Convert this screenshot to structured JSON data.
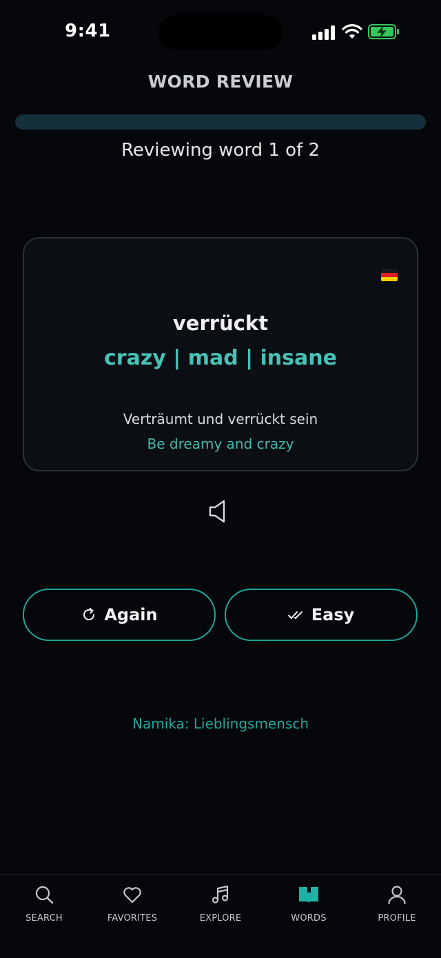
{
  "status_bar": {
    "time": "9:41"
  },
  "header": {
    "title": "WORD REVIEW",
    "progress_text": "Reviewing word 1 of 2",
    "progress_fraction": 0
  },
  "card": {
    "flag_icon": "germany-flag",
    "word": "verrückt",
    "translations": "crazy | mad | insane",
    "example": "Verträumt und verrückt sein",
    "example_translation": "Be dreamy and crazy"
  },
  "actions": {
    "again_label": "Again",
    "easy_label": "Easy"
  },
  "source": "Namika: Lieblingsmensch",
  "tabs": [
    {
      "label": "SEARCH",
      "icon": "search-icon"
    },
    {
      "label": "FAVORITES",
      "icon": "heart-icon"
    },
    {
      "label": "EXPLORE",
      "icon": "music-note-icon"
    },
    {
      "label": "WORDS",
      "icon": "book-icon",
      "active": true
    },
    {
      "label": "PROFILE",
      "icon": "user-icon"
    }
  ],
  "colors": {
    "accent": "#1fa79c",
    "background": "#05070a",
    "translation": "#48c2b6"
  }
}
